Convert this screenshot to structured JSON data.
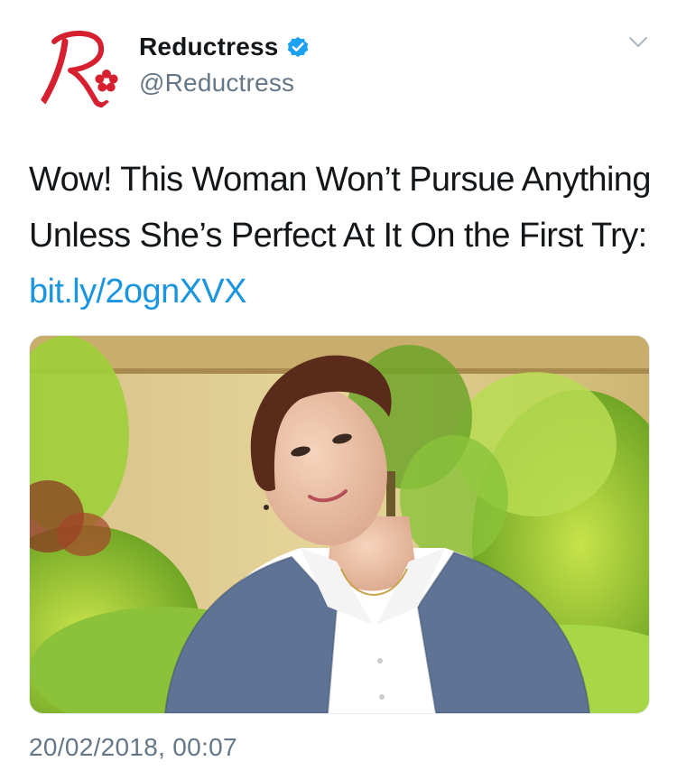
{
  "user": {
    "display_name": "Reductress",
    "handle": "@Reductress",
    "verified": true,
    "avatar_icon": "reductress-logo-icon",
    "brand_color": "#d6202f"
  },
  "tweet": {
    "text": "Wow! This Woman Won’t Pursue Anything Unless She’s Perfect At It On the First Try:",
    "link_text": "bit.ly/2ognXVX",
    "link_color": "#1b95e0",
    "timestamp": "20/02/2018, 00:07"
  },
  "media": {
    "icon": "photo-woman-in-garden"
  },
  "menu": {
    "icon": "chevron-down-icon"
  },
  "colors": {
    "text": "#14171a",
    "secondary": "#657786",
    "verified_badge": "#1da1f2"
  }
}
